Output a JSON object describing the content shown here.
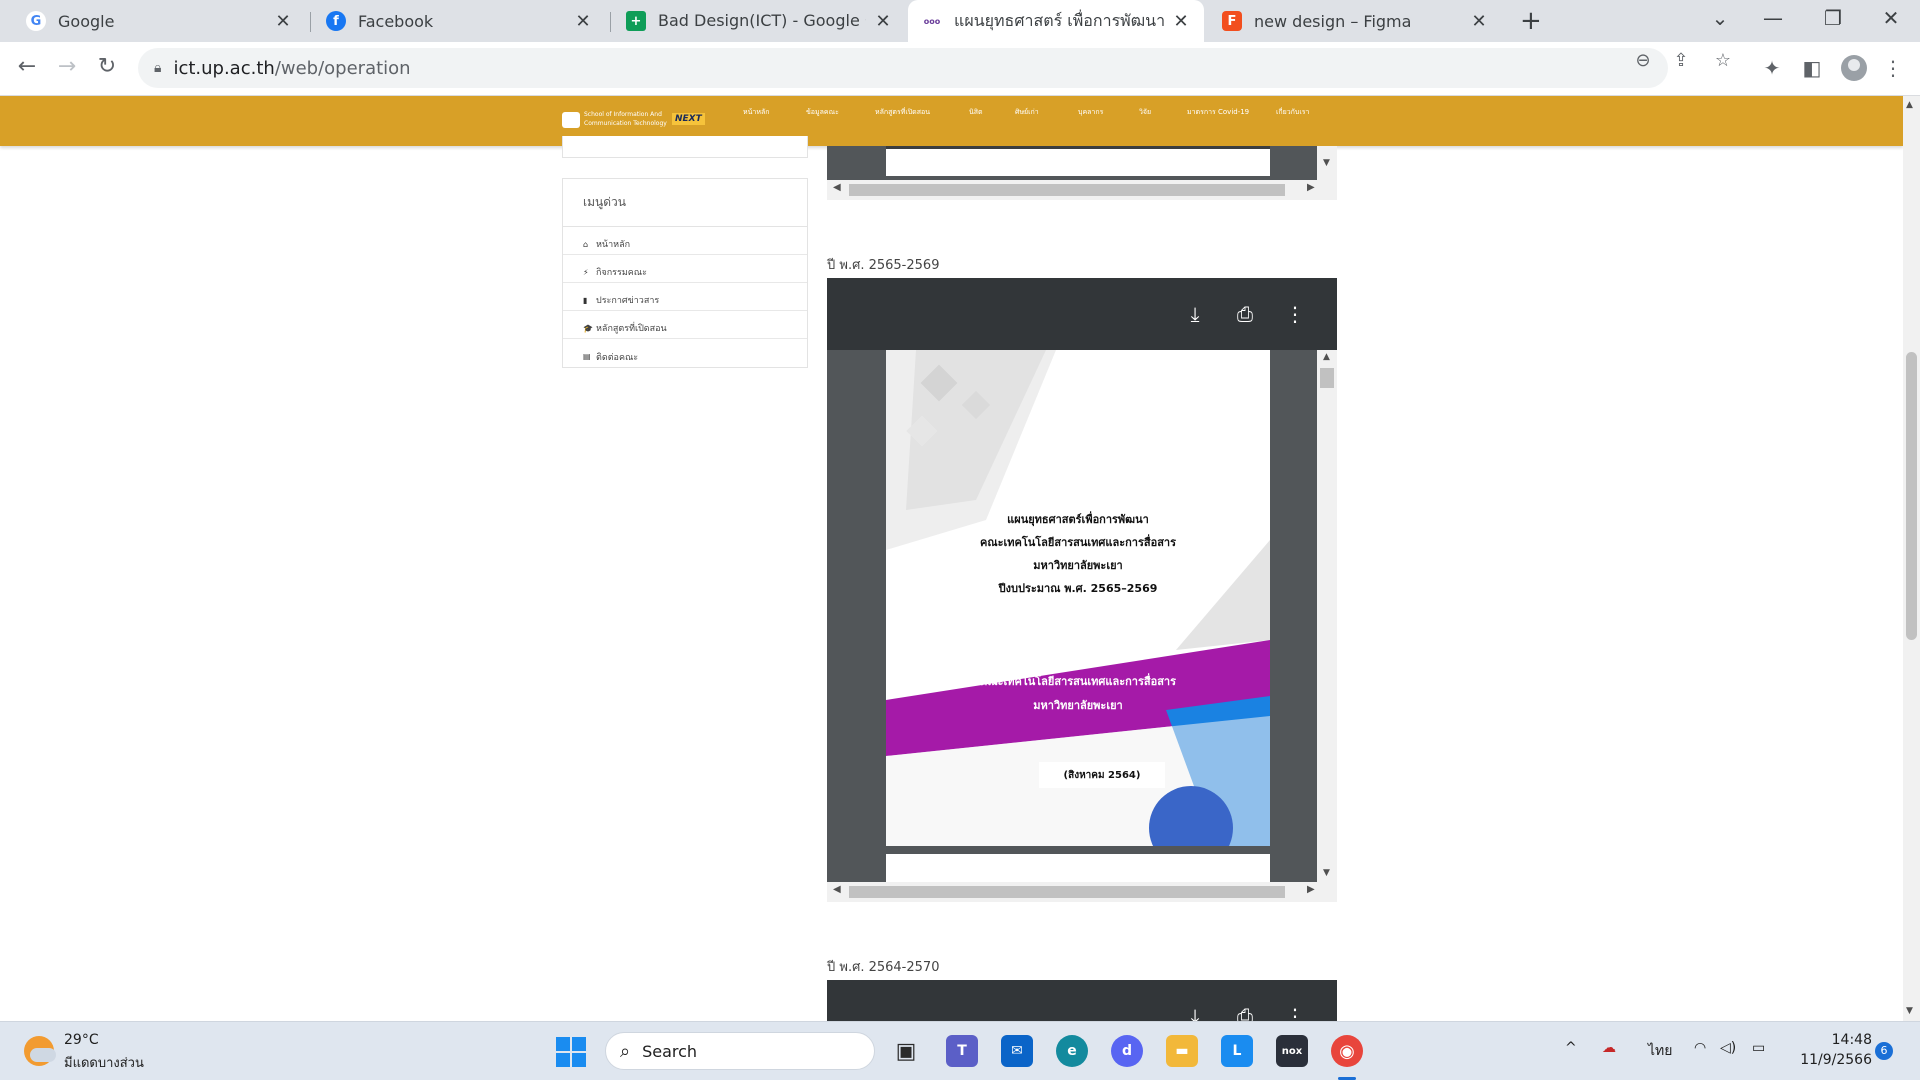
{
  "browser": {
    "tabs": [
      {
        "title": "Google",
        "close": "✕",
        "favicon": "G",
        "color": "#4285f4"
      },
      {
        "title": "Facebook",
        "close": "✕",
        "favicon": "f",
        "color": "#1877f2"
      },
      {
        "title": "Bad Design(ICT) - Google ชีต",
        "close": "✕",
        "favicon": "+",
        "color": "#0f9d58"
      },
      {
        "title": "แผนยุทธศาสตร์ เพื่อการพัฒนา - Scho",
        "close": "✕",
        "favicon": "ооо",
        "color": "#6a3d9a"
      },
      {
        "title": "new design – Figma",
        "close": "✕",
        "favicon": "F",
        "color": "#f24e1e"
      }
    ],
    "new_tab": "+",
    "window_controls": {
      "tab_search": "⌄",
      "minimize": "—",
      "restore": "❐",
      "close": "✕"
    },
    "nav": {
      "back": "←",
      "forward": "→",
      "reload": "↻"
    },
    "url_host": "ict.up.ac.th",
    "url_path": "/web/operation",
    "icons": {
      "zoom": "⊖",
      "share": "⇪",
      "bookmark": "☆",
      "extensions": "✦",
      "sidebar": "◧",
      "menu": "⋮"
    }
  },
  "site": {
    "logo_text": "School of Information And\nCommunication Technology",
    "logo_badge": "NEXT",
    "menu": [
      "หน้าหลัก",
      "ข้อมูลคณะ",
      "หลักสูตรที่เปิดสอน",
      "นิสิต",
      "ศิษย์เก่า",
      "บุคลากร",
      "วิจัย",
      "มาตรการ Covid-19",
      "เกี่ยวกับเรา"
    ],
    "sidebar": {
      "title": "เมนูด่วน",
      "items": [
        {
          "icon": "⌂",
          "label": "หน้าหลัก"
        },
        {
          "icon": "⚡",
          "label": "กิจกรรมคณะ"
        },
        {
          "icon": "▮",
          "label": "ประกาศข่าวสาร"
        },
        {
          "icon": "🎓",
          "label": "หลักสูตรที่เปิดสอน"
        },
        {
          "icon": "▤",
          "label": "ติดต่อคณะ"
        }
      ]
    },
    "sections": [
      {
        "label": "ปี พ.ศ. 2565-2569"
      },
      {
        "label": "ปี พ.ศ. 2564-2570"
      }
    ],
    "pdf_toolbar": {
      "download": "⤓",
      "print": "⎙",
      "more": "⋮"
    },
    "cover": {
      "line1": "แผนยุทธศาสตร์เพื่อการพัฒนา",
      "line2": "คณะเทคโนโลยีสารสนเทศและการสื่อสาร",
      "line3": "มหาวิทยาลัยพะเยา",
      "line4": "ปีงบประมาณ พ.ศ. 2565–2569",
      "band1": "คณะเทคโนโลยีสารสนเทศและการสื่อสาร",
      "band2": "มหาวิทยาลัยพะเยา",
      "date": "(สิงหาคม 2564)",
      "band_color": "#a51aa8",
      "accent_blue": "#1a82e2"
    }
  },
  "taskbar": {
    "weather_temp": "29°C",
    "weather_desc": "มีแดดบางส่วน",
    "search_placeholder": "Search",
    "apps": [
      {
        "name": "task-view",
        "glyph": "▣",
        "color": "#2b2b2b"
      },
      {
        "name": "teams",
        "glyph": "T",
        "color": "#5b5fc7"
      },
      {
        "name": "mail",
        "glyph": "✉",
        "color": "#0a64c8"
      },
      {
        "name": "edge",
        "glyph": "e",
        "color": "#138a9e"
      },
      {
        "name": "discord",
        "glyph": "d",
        "color": "#5865f2"
      },
      {
        "name": "file-explorer",
        "glyph": "▬",
        "color": "#f2b83a"
      },
      {
        "name": "line-app",
        "glyph": "L",
        "color": "#1a8cf0"
      },
      {
        "name": "nox-player",
        "glyph": "nox",
        "color": "#2a2f3a"
      },
      {
        "name": "chrome",
        "glyph": "◉",
        "color": "#e8453c"
      }
    ],
    "tray_chevron": "^",
    "language": "ไทย",
    "wifi": "◠",
    "volume": "◁)",
    "battery": "▭",
    "time": "14:48",
    "date": "11/9/2566",
    "notifications": "6"
  }
}
